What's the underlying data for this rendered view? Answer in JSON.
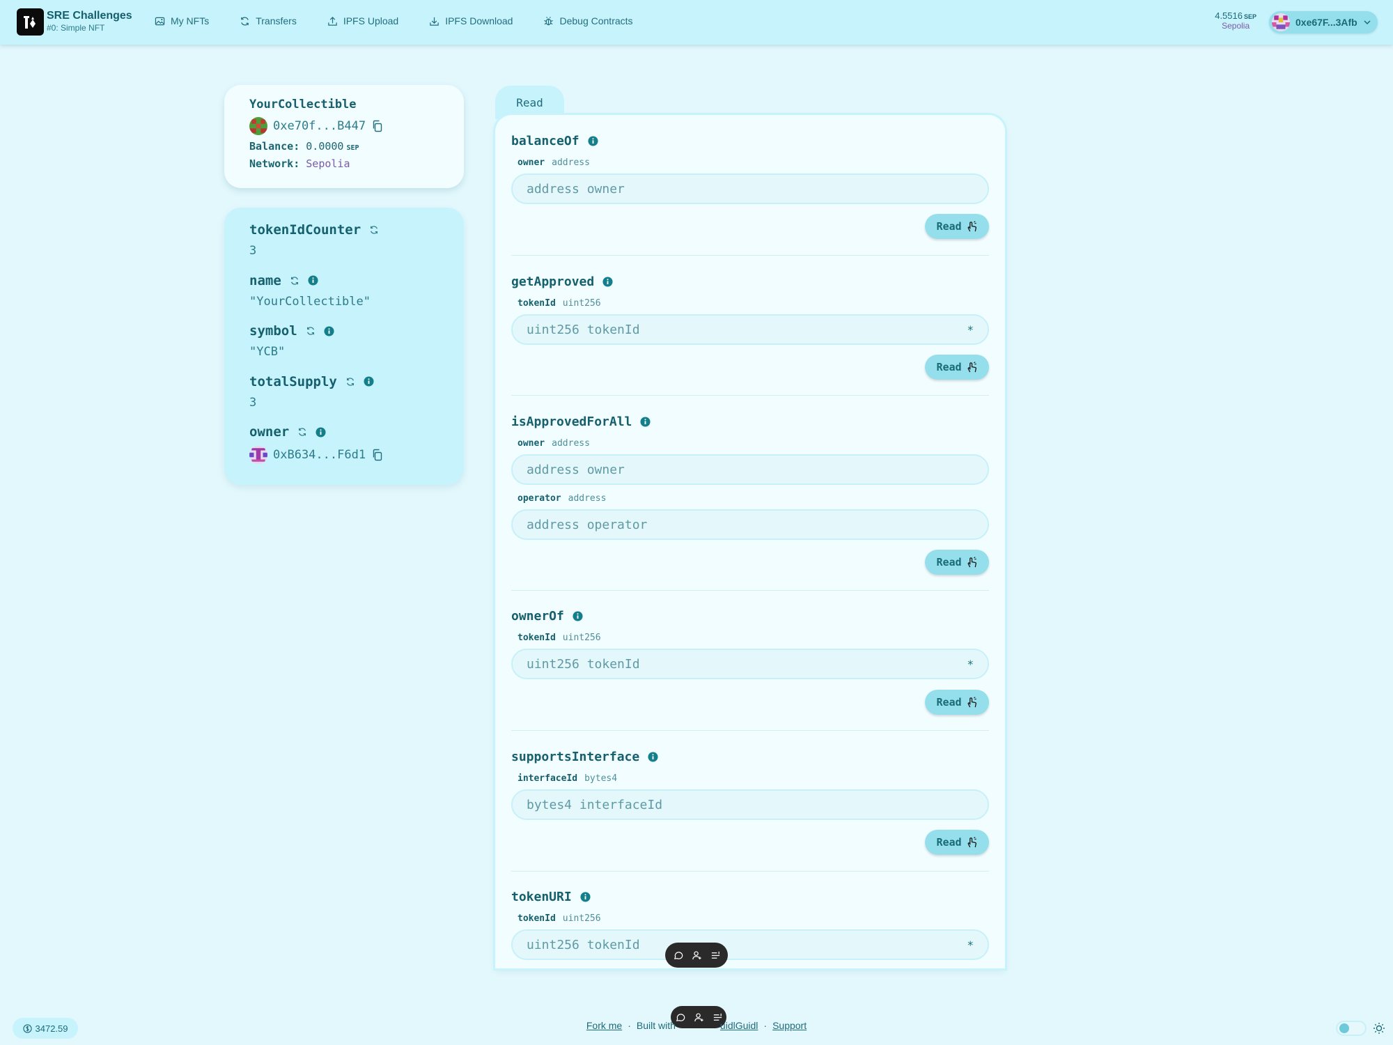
{
  "header": {
    "brand_title": "SRE Challenges",
    "brand_subtitle": "#0: Simple NFT",
    "nav": [
      {
        "label": "My NFTs",
        "icon": "image-icon"
      },
      {
        "label": "Transfers",
        "icon": "refresh-icon"
      },
      {
        "label": "IPFS Upload",
        "icon": "upload-icon"
      },
      {
        "label": "IPFS Download",
        "icon": "download-icon"
      },
      {
        "label": "Debug Contracts",
        "icon": "bug-icon"
      }
    ],
    "balance_value": "4.5516",
    "balance_unit": "SEP",
    "network": "Sepolia",
    "wallet_address": "0xe67F...3Afb"
  },
  "contract_card": {
    "name": "YourCollectible",
    "address": "0xe70f...B447",
    "balance_label": "Balance:",
    "balance_value": "0.0000",
    "balance_unit": "SEP",
    "network_label": "Network:",
    "network_value": "Sepolia"
  },
  "variables": [
    {
      "name": "tokenIdCounter",
      "value": "3"
    },
    {
      "name": "name",
      "value": "\"YourCollectible\""
    },
    {
      "name": "symbol",
      "value": "\"YCB\""
    },
    {
      "name": "totalSupply",
      "value": "3"
    },
    {
      "name": "owner",
      "value": "0xB634...F6d1"
    }
  ],
  "tab_label": "Read",
  "read_button_label": "Read",
  "functions": [
    {
      "name": "balanceOf",
      "params": [
        {
          "name": "owner",
          "type": "address",
          "placeholder": "address owner"
        }
      ]
    },
    {
      "name": "getApproved",
      "params": [
        {
          "name": "tokenId",
          "type": "uint256",
          "placeholder": "uint256 tokenId",
          "star": "*"
        }
      ]
    },
    {
      "name": "isApprovedForAll",
      "params": [
        {
          "name": "owner",
          "type": "address",
          "placeholder": "address owner"
        },
        {
          "name": "operator",
          "type": "address",
          "placeholder": "address operator"
        }
      ]
    },
    {
      "name": "ownerOf",
      "params": [
        {
          "name": "tokenId",
          "type": "uint256",
          "placeholder": "uint256 tokenId",
          "star": "*"
        }
      ]
    },
    {
      "name": "supportsInterface",
      "params": [
        {
          "name": "interfaceId",
          "type": "bytes4",
          "placeholder": "bytes4 interfaceId"
        }
      ]
    },
    {
      "name": "tokenURI",
      "params": [
        {
          "name": "tokenId",
          "type": "uint256",
          "placeholder": "uint256 tokenId",
          "star": "*"
        }
      ]
    }
  ],
  "footer": {
    "fork": "Fork me",
    "sep1": "·",
    "built_with": "Built with",
    "buidl": "uidlGuidl",
    "sep2": "·",
    "support": "Support",
    "price": "3472.59"
  },
  "colors": {
    "background": "#e3f8fd",
    "navbar": "#c7f3fd",
    "accent": "#95dfec",
    "text": "#15606c",
    "network": "#7a5aa9"
  }
}
